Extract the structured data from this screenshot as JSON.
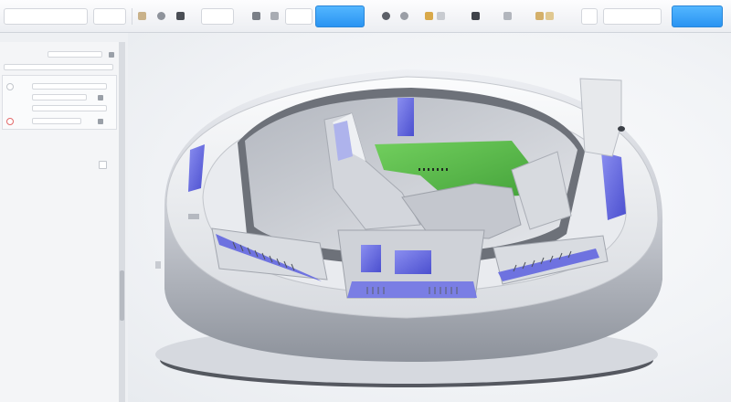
{
  "toolbar": {
    "button_left": "",
    "button_right": "",
    "icons": [
      "move-icon",
      "select-icon",
      "zoom-icon",
      "layer-icon",
      "pan-icon",
      "rotate-icon",
      "view-icon",
      "orbit-icon",
      "light-icon",
      "camera-icon",
      "align-icon",
      "snap-icon"
    ]
  },
  "panel": {
    "rows": [
      "",
      "",
      "",
      "",
      ""
    ],
    "section_labels": [
      "",
      ""
    ]
  },
  "viewport": {
    "model": "circular-structure-3d",
    "accent": "#5b5fdc",
    "floor_color": "#58b84b"
  },
  "colors": {
    "primary_button": "#2a94f2",
    "panel_bg": "#f4f5f7"
  }
}
